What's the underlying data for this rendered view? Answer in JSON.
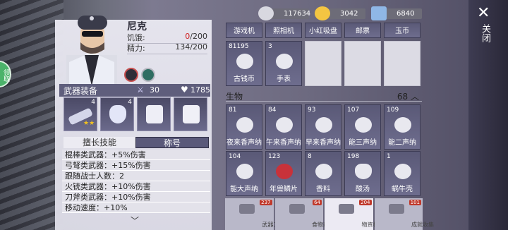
{
  "character": {
    "name": "尼克",
    "hunger_label": "饥饿:",
    "hunger_current": "0",
    "hunger_max": "/200",
    "energy_label": "精力:",
    "energy_value": "134/200",
    "green_badge": "领取"
  },
  "equipment": {
    "label": "武器装备",
    "attack": "30",
    "hp": "1785",
    "item1_count": "4",
    "item2_count": "4"
  },
  "tabs": {
    "skills": "擅长技能",
    "title": "称号"
  },
  "skills": [
    "棍棒类武器：+5%伤害",
    "弓弩类武器：+15%伤害",
    "跟随战士人数：2",
    "火铳类武器：+10%伤害",
    "刀斧类武器：+10%伤害",
    "移动速度：+10%"
  ],
  "resources": {
    "silver": "117634",
    "gold": "3042",
    "ticket": "6840"
  },
  "top_row": [
    "游戏机",
    "照相机",
    "小红吸盘",
    "邮票",
    "玉币"
  ],
  "items": [
    {
      "count": "81195",
      "label": "古钱币"
    },
    {
      "count": "3",
      "label": "手表"
    }
  ],
  "section": {
    "title": "生物",
    "count": "68"
  },
  "creatures": [
    {
      "count": "81",
      "label": "夜来香声纳"
    },
    {
      "count": "84",
      "label": "午来香声纳"
    },
    {
      "count": "93",
      "label": "早来香声纳"
    },
    {
      "count": "107",
      "label": "能三声纳"
    },
    {
      "count": "109",
      "label": "能二声纳"
    },
    {
      "count": "104",
      "label": "能大声纳"
    },
    {
      "count": "123",
      "label": "年兽鳞片"
    },
    {
      "count": "8",
      "label": "香料"
    },
    {
      "count": "198",
      "label": "酸汤"
    },
    {
      "count": "1",
      "label": "蜗牛壳"
    }
  ],
  "bottom_tabs": [
    {
      "label": "武器工具",
      "badge": "237"
    },
    {
      "label": "食物药品",
      "badge": "64"
    },
    {
      "label": "物资材料",
      "badge": "204"
    },
    {
      "label": "成就收集",
      "badge": "101"
    }
  ],
  "close": {
    "label": "关闭"
  }
}
